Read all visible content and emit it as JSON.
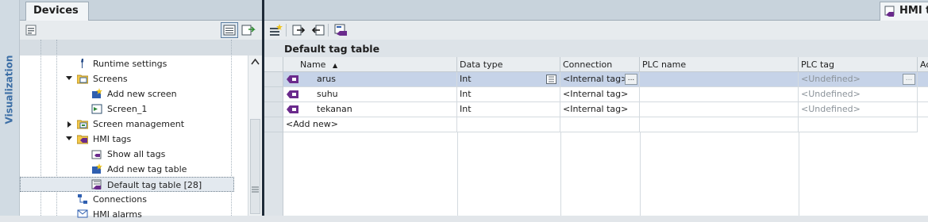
{
  "sidebar": {
    "vertical_label": "Visualization"
  },
  "devices_tab": {
    "label": "Devices"
  },
  "tree": {
    "items": [
      {
        "label": "Runtime settings",
        "icon": "wrench-icon"
      },
      {
        "label": "Screens",
        "icon": "folder-icon",
        "expanded": true
      },
      {
        "label": "Add new screen",
        "icon": "add-screen-icon"
      },
      {
        "label": "Screen_1",
        "icon": "screen-icon"
      },
      {
        "label": "Screen management",
        "icon": "folder-screen-icon",
        "expanded": false
      },
      {
        "label": "HMI tags",
        "icon": "folder-tag-icon",
        "expanded": true
      },
      {
        "label": "Show all tags",
        "icon": "tags-icon"
      },
      {
        "label": "Add new tag table",
        "icon": "add-tag-table-icon"
      },
      {
        "label": "Default tag table [28]",
        "icon": "tag-table-icon",
        "selected": true
      },
      {
        "label": "Connections",
        "icon": "connections-icon"
      },
      {
        "label": "HMI alarms",
        "icon": "alarms-icon"
      }
    ]
  },
  "editor": {
    "tab_label": "HMI tags",
    "title": "Default tag table",
    "columns": [
      "Name",
      "Data type",
      "Connection",
      "PLC name",
      "PLC tag",
      "Ac"
    ],
    "sort_indicator": "▲",
    "rows": [
      {
        "name": "arus",
        "data_type": "Int",
        "connection": "<Internal tag>",
        "plc_name": "",
        "plc_tag": "<Undefined>",
        "selected": true
      },
      {
        "name": "suhu",
        "data_type": "Int",
        "connection": "<Internal tag>",
        "plc_name": "",
        "plc_tag": "<Undefined>"
      },
      {
        "name": "tekanan",
        "data_type": "Int",
        "connection": "<Internal tag>",
        "plc_name": "",
        "plc_tag": "<Undefined>"
      }
    ],
    "add_new_label": "<Add new>",
    "ellipsis": "...",
    "colors": {
      "selected_row": "#c6d3e8",
      "tag_icon": "#6a2a8c",
      "splitter": "#1f2b38"
    }
  }
}
